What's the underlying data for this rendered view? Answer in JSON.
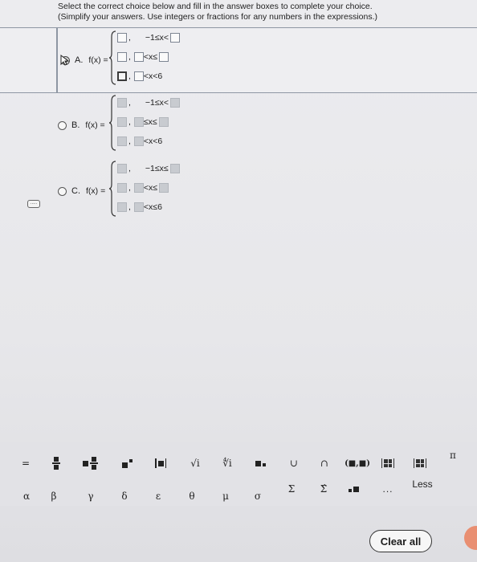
{
  "instructions": {
    "line1": "Select the correct choice below and fill in the answer boxes to complete your choice.",
    "line2": "(Simplify your answers. Use integers or fractions for any numbers in the expressions.)"
  },
  "choices": [
    {
      "letter": "A.",
      "fx": "f(x) =",
      "selected": true,
      "rows": [
        {
          "cond": "−1≤x<"
        },
        {
          "cond": "<x≤"
        },
        {
          "cond": "<x<6"
        }
      ]
    },
    {
      "letter": "B.",
      "fx": "f(x) =",
      "selected": false,
      "rows": [
        {
          "cond": "−1≤x<"
        },
        {
          "cond": "≤x≤"
        },
        {
          "cond": "<x<6"
        }
      ]
    },
    {
      "letter": "C.",
      "fx": "f(x) =",
      "selected": false,
      "rows": [
        {
          "cond": "−1≤x≤"
        },
        {
          "cond": "<x≤"
        },
        {
          "cond": "<x≤6"
        }
      ]
    }
  ],
  "side_tab": {
    "label": "....."
  },
  "toolbar": {
    "row1": [
      "=",
      "fraction",
      "mixed-number",
      "superscript",
      "absolute-value",
      "√i",
      "∜i",
      "subscript",
      "∪",
      "∩",
      "(■,■)",
      "matrix",
      "matrix-2",
      "π"
    ],
    "row2": [
      "α",
      "β",
      "γ",
      "δ",
      "ε",
      "θ",
      "μ",
      "σ",
      "Σ",
      "Σ̂",
      "dot-exp",
      "...",
      "Less"
    ],
    "sqrt_label": "√i",
    "nthroot_label": "∜i",
    "union_label": "∪",
    "intersect_label": "∩",
    "interval_label": "(■,■)",
    "pi_label": "π",
    "equals_label": "=",
    "alpha": "α",
    "beta": "β",
    "gamma": "γ",
    "delta": "δ",
    "epsilon": "ε",
    "theta": "θ",
    "mu": "μ",
    "sigma": "σ",
    "Sigma": "Σ",
    "Sigma_hat": "Σ̂",
    "ellipsis": "...",
    "less": "Less"
  },
  "clear_all": "Clear all",
  "colors": {
    "accent": "#e98f72",
    "border": "#8e96a3"
  }
}
